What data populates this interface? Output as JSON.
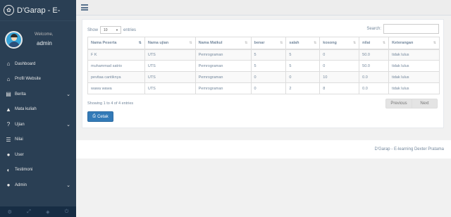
{
  "brand": {
    "title": "D'Garap - E-",
    "icon": "paw-icon"
  },
  "profile": {
    "welcome": "Welcome,",
    "name": "admin"
  },
  "menu": [
    {
      "label": "Dashboard",
      "icon": "home-icon",
      "chevron": false
    },
    {
      "label": "Profil Website",
      "icon": "institution-icon",
      "chevron": false
    },
    {
      "label": "Berita",
      "icon": "newspaper-icon",
      "chevron": true
    },
    {
      "label": "Mata kuliah",
      "icon": "graduation-cap-icon",
      "chevron": false
    },
    {
      "label": "Ujian",
      "icon": "question-circle-icon",
      "chevron": true
    },
    {
      "label": "Nilai",
      "icon": "list-icon",
      "chevron": false
    },
    {
      "label": "User",
      "icon": "users-icon",
      "chevron": false
    },
    {
      "label": "Testimoni",
      "icon": "comments-icon",
      "chevron": false
    },
    {
      "label": "Admin",
      "icon": "user-icon",
      "chevron": true
    }
  ],
  "table_controls": {
    "show_label": "Show",
    "entries_value": "10",
    "entries_label": "entries",
    "search_label": "Search:",
    "search_value": ""
  },
  "table": {
    "headers": [
      "Nama Peserta",
      "Nama ujian",
      "Nama Matkul",
      "benar",
      "salah",
      "kosong",
      "nilai",
      "Keterangan"
    ],
    "rows": [
      [
        "F K",
        "UTS",
        "Pemrograman",
        "5",
        "5",
        "0",
        "50.0",
        "tidak lulus"
      ],
      [
        "muhammad satrio",
        "UTS",
        "Pemrograman",
        "5",
        "5",
        "0",
        "50.0",
        "tidak lulus"
      ],
      [
        "pevitaa cantiknya",
        "UTS",
        "Pemrograman",
        "0",
        "0",
        "10",
        "0.0",
        "tidak lulus"
      ],
      [
        "wawa wawa",
        "UTS",
        "Pemrograman",
        "0",
        "2",
        "8",
        "0.0",
        "tidak lulus"
      ]
    ]
  },
  "table_info": "Showing 1 to 4 of 4 entries",
  "pagination": {
    "previous": "Previous",
    "next": "Next"
  },
  "print_button": {
    "label": "Cetak",
    "icon": "print-icon"
  },
  "footer": {
    "text": "D'Garap - E-learning Dexter Pratama"
  },
  "colors": {
    "sidebar": "#2a3f54",
    "accent": "#337ab7"
  }
}
